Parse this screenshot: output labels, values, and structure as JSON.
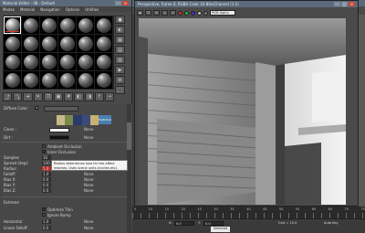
{
  "material_editor": {
    "title": "Material Editor - 08 - Default",
    "menu": [
      "Modes",
      "Material",
      "Navigation",
      "Options",
      "Utilities"
    ],
    "slot_count": 24,
    "active_slot": 0,
    "diffuse_label": "Diffuse Color:",
    "multi_button": "Multi/Sub",
    "props": {
      "clean_label": "Clean :",
      "dirt_label": "Dirt :",
      "none_label": "None",
      "ambient_occlusion": "Ambient Occlusion",
      "inner_occlusion": "Inner Occlusion",
      "samples_label": "Samples",
      "spread_label": "Spread (deg):",
      "radius_label": "Radius:",
      "falloff_label": "Falloff:",
      "bias_x_label": "Bias X:",
      "bias_y_label": "Bias Y:",
      "bias_z_label": "Bias Z:",
      "extreme_label": "Extreme",
      "optimize_thin": "Optimize Thin",
      "ignore_bump": "Ignore Bump",
      "horizontal_label": "Horizontal",
      "linear_label": "Linear Falloff:",
      "spread_value": "100.0",
      "radius_value": "5.0",
      "falloff_value": "1.0",
      "bias_x_value": "0.0",
      "bias_y_value": "0.0",
      "bias_z_value": "0.0",
      "samples_value": "16",
      "horizontal_value": "1.0",
      "linear_value": "0.0"
    },
    "tooltip": "Radius determines how far the effect reaches. Uses scene units (inches etc)."
  },
  "render_window": {
    "title": "Perspective, frame 0, RGBA Color 16 Bits/Channel (1:1)",
    "channel": "RGB Alpha"
  },
  "timeline": {
    "ticks": [
      "5",
      "10",
      "15",
      "20",
      "25",
      "30",
      "35",
      "40",
      "45",
      "50",
      "55",
      "60",
      "65",
      "70",
      "75"
    ]
  },
  "statusbar": {
    "x_label": "X:",
    "x_value": "0.0",
    "y_label": "Y:",
    "y_value": "0.0",
    "grid_label": "Grid = 10.0",
    "auto_key": "Auto Key",
    "selected": "Selected"
  },
  "colors": {
    "render_bg": "#555555",
    "tooltip_bg": "#f3f3f3",
    "accent_red": "#b52a2a",
    "multi_btn": "#4a7fb0"
  }
}
